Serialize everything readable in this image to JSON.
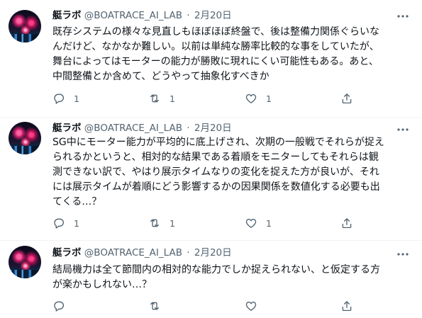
{
  "tweets": [
    {
      "name": "艇ラボ",
      "handle": "@BOATRACE_AI_LAB",
      "separator": "·",
      "time": "2月20日",
      "lines": [
        "既存システムの様々な見直しもほぼほぼ終盤で、後は整備力関係ぐらいな",
        "んだけど、なかなか難しい。以前は単純な勝率比較的な事をしていたが、",
        "舞台によってはモーターの能力が勝敗に現れにくい可能性もある。あと、",
        "中間整備とか含めて、どうやって抽象化すべきか"
      ],
      "replies": "1",
      "retweets": "1",
      "likes": "1"
    },
    {
      "name": "艇ラボ",
      "handle": "@BOATRACE_AI_LAB",
      "separator": "·",
      "time": "2月20日",
      "lines": [
        "SG中にモーター能力が平均的に底上げされ、次期の一般戦でそれらが捉え",
        "られるかというと、相対的な結果である着順をモニターしてもそれらは観",
        "測できない訳で、やはり展示タイムなりの変化を捉えた方が良いが、それ",
        "には展示タイムが着順にどう影響するかの因果関係を数値化する必要も出",
        "てくる…？"
      ],
      "replies": "1",
      "retweets": "1",
      "likes": "1"
    },
    {
      "name": "艇ラボ",
      "handle": "@BOATRACE_AI_LAB",
      "separator": "·",
      "time": "2月20日",
      "lines": [
        "結局機力は全て節間内の相対的な能力でしか捉えられない、と仮定する方",
        "が楽かもしれない…？"
      ],
      "replies": "",
      "retweets": "",
      "likes": ""
    }
  ],
  "icons": {
    "more": "more-horizontal-icon",
    "reply": "reply-bubble-icon",
    "retweet": "retweet-icon",
    "like": "heart-icon",
    "share": "share-upload-icon"
  },
  "colors": {
    "text": "#0f1419",
    "secondary": "#536471",
    "divider": "#eff3f4",
    "background": "#ffffff"
  }
}
